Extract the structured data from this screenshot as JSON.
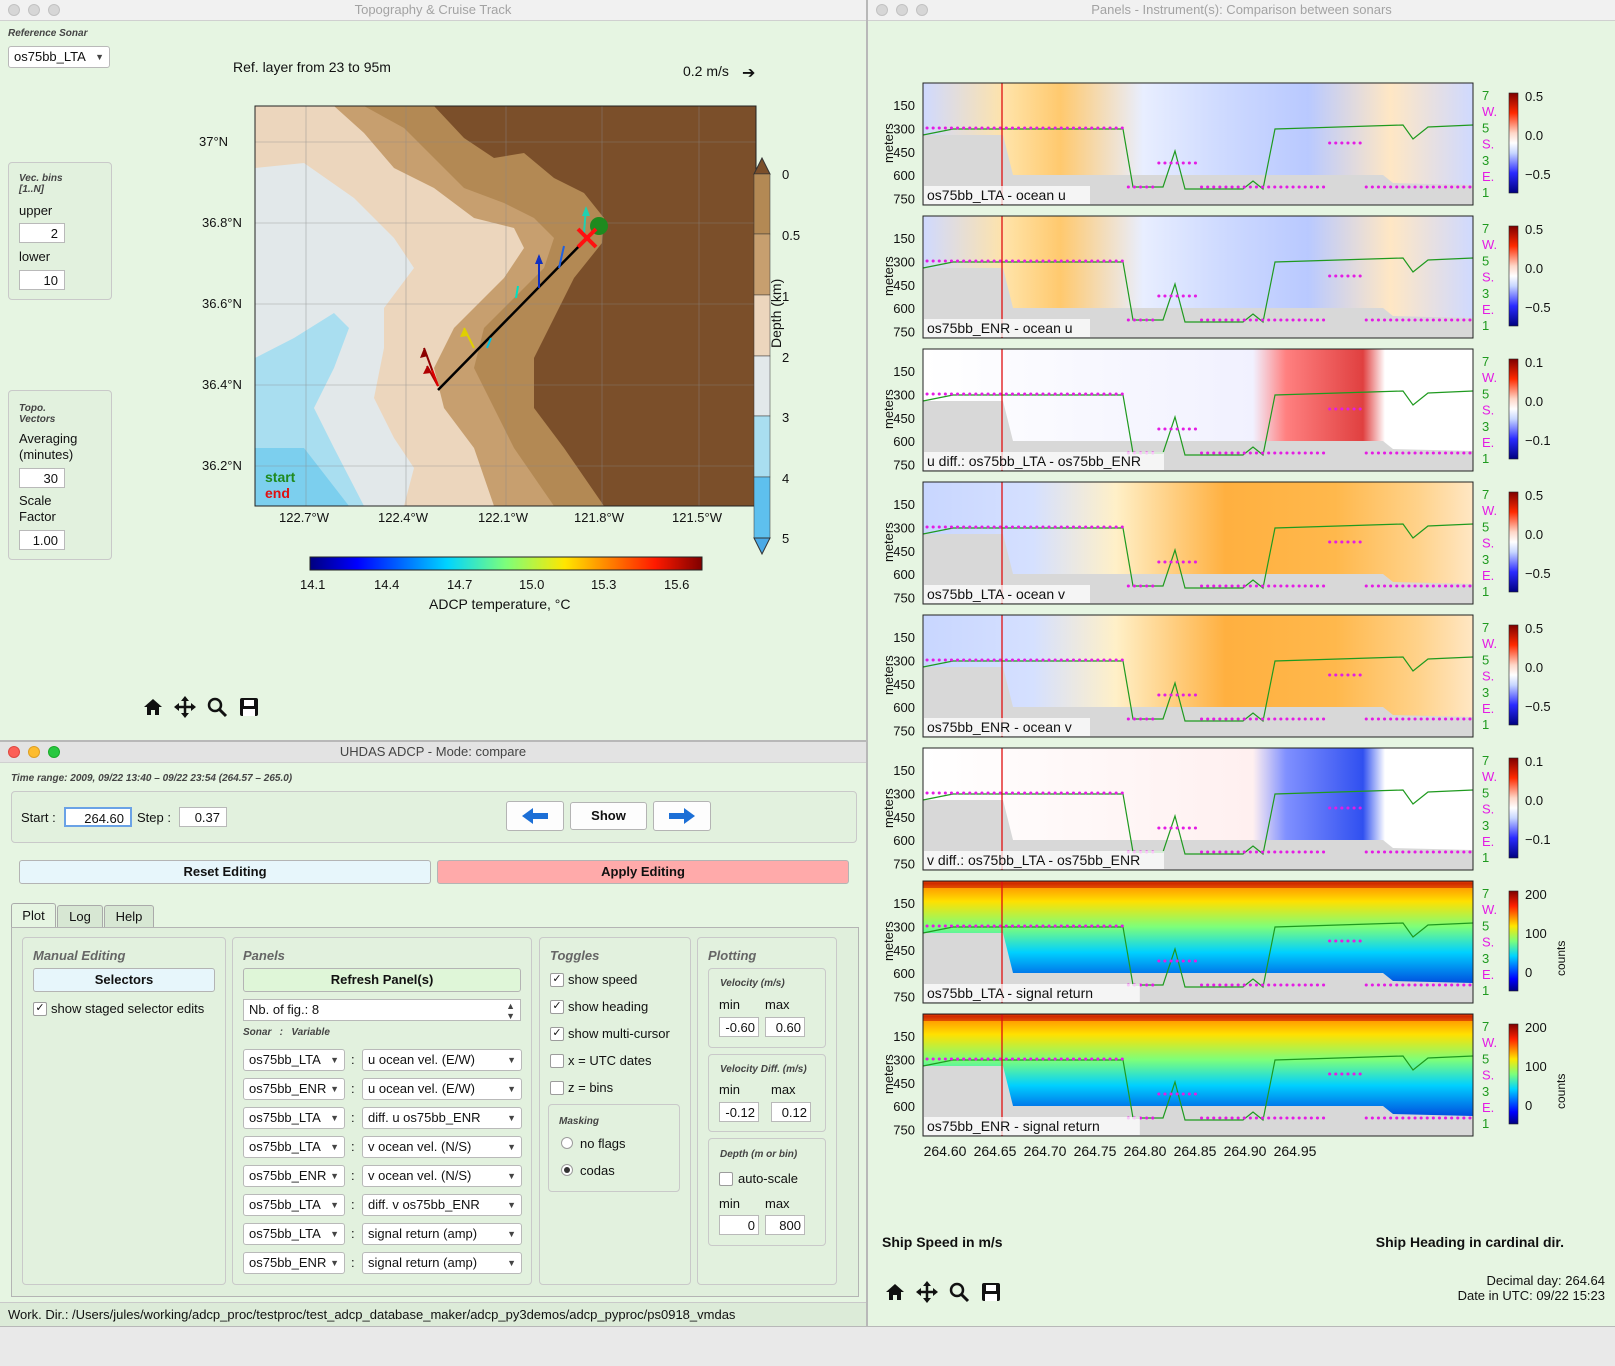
{
  "topo_window": {
    "title": "Topography & Cruise Track",
    "reference_sonar_label": "Reference Sonar",
    "reference_sonar_value": "os75bb_LTA",
    "vec_bins_label": "Vec. bins\n[1..N]",
    "upper_label": "upper",
    "upper_value": "2",
    "lower_label": "lower",
    "lower_value": "10",
    "topo_vectors_label": "Topo.\nVectors",
    "averaging_label": "Averaging\n(minutes)",
    "averaging_value": "30",
    "scale_factor_label": "Scale\nFactor",
    "scale_factor_value": "1.00",
    "ref_layer_text": "Ref. layer from 23 to 95m",
    "scale_arrow_text": "0.2 m/s",
    "lat_ticks": [
      "37°N",
      "36.8°N",
      "36.6°N",
      "36.4°N",
      "36.2°N"
    ],
    "lon_ticks": [
      "122.7°W",
      "122.4°W",
      "122.1°W",
      "121.8°W",
      "121.5°W"
    ],
    "depth_ticks": [
      "0",
      "0.5",
      "1",
      "2",
      "3",
      "4",
      "5"
    ],
    "depth_label": "Depth (km)",
    "temp_ticks": [
      "14.1",
      "14.4",
      "14.7",
      "15.0",
      "15.3",
      "15.6"
    ],
    "temp_label": "ADCP temperature, °C",
    "start_label": "start",
    "end_label": "end",
    "colors": {
      "start": "#1e8a1e",
      "end": "#e01010"
    }
  },
  "panels_window": {
    "title": "Panels - Instrument(s): Comparison between sonars",
    "ship_speed_label": "Ship Speed in m/s",
    "ship_heading_label": "Ship Heading in cardinal dir.",
    "decimal_day": "Decimal day: 264.64",
    "date_utc": "Date in UTC: 09/22 15:23",
    "x_ticks": [
      "264.60",
      "264.65",
      "264.70",
      "264.75",
      "264.80",
      "264.85",
      "264.90",
      "264.95"
    ],
    "y_ticks": [
      "150",
      "300",
      "450",
      "600",
      "750"
    ],
    "y_label": "meters",
    "right_ticks": [
      "7",
      "W.",
      "5",
      "S.",
      "3",
      "E.",
      "1"
    ],
    "panels": [
      {
        "label": "os75bb_LTA - ocean u",
        "kind": "vel",
        "cbar": [
          "0.5",
          "0.0",
          "−0.5"
        ],
        "cbar_unit": ""
      },
      {
        "label": "os75bb_ENR - ocean u",
        "kind": "vel",
        "cbar": [
          "0.5",
          "0.0",
          "−0.5"
        ],
        "cbar_unit": ""
      },
      {
        "label": "u diff.: os75bb_LTA - os75bb_ENR",
        "kind": "diffu",
        "cbar": [
          "0.1",
          "0.0",
          "−0.1"
        ],
        "cbar_unit": ""
      },
      {
        "label": "os75bb_LTA - ocean v",
        "kind": "velv",
        "cbar": [
          "0.5",
          "0.0",
          "−0.5"
        ],
        "cbar_unit": ""
      },
      {
        "label": "os75bb_ENR - ocean v",
        "kind": "velv",
        "cbar": [
          "0.5",
          "0.0",
          "−0.5"
        ],
        "cbar_unit": ""
      },
      {
        "label": "v diff.: os75bb_LTA - os75bb_ENR",
        "kind": "diffv",
        "cbar": [
          "0.1",
          "0.0",
          "−0.1"
        ],
        "cbar_unit": ""
      },
      {
        "label": "os75bb_LTA - signal return",
        "kind": "amp",
        "cbar": [
          "200",
          "100",
          "0"
        ],
        "cbar_unit": "counts"
      },
      {
        "label": "os75bb_ENR - signal return",
        "kind": "amp",
        "cbar": [
          "200",
          "100",
          "0"
        ],
        "cbar_unit": "counts"
      }
    ],
    "colors": {
      "speed": "#1f9a1f",
      "heading": "#e41ce4"
    }
  },
  "control_window": {
    "title": "UHDAS ADCP - Mode: compare",
    "time_range": "Time range: 2009, 09/22 13:40 – 09/22 23:54 (264.57 – 265.0)",
    "start_label": "Start :",
    "start_value": "264.60",
    "step_label": "Step :",
    "step_value": "0.37",
    "show_label": "Show",
    "reset_label": "Reset Editing",
    "apply_label": "Apply Editing",
    "tabs": [
      "Plot",
      "Log",
      "Help"
    ],
    "manual_editing_title": "Manual Editing",
    "selectors_label": "Selectors",
    "show_staged_label": "show staged selector edits",
    "panels_title": "Panels",
    "refresh_label": "Refresh Panel(s)",
    "nb_fig_label": "Nb. of fig.: 8",
    "sonar_variable_header": "Sonar   :   Variable",
    "rows": [
      {
        "sonar": "os75bb_LTA",
        "variable": "u ocean vel. (E/W)"
      },
      {
        "sonar": "os75bb_ENR",
        "variable": "u ocean vel. (E/W)"
      },
      {
        "sonar": "os75bb_LTA",
        "variable": "diff.  u os75bb_ENR"
      },
      {
        "sonar": "os75bb_LTA",
        "variable": "v ocean vel. (N/S)"
      },
      {
        "sonar": "os75bb_ENR",
        "variable": "v ocean vel. (N/S)"
      },
      {
        "sonar": "os75bb_LTA",
        "variable": "diff.  v os75bb_ENR"
      },
      {
        "sonar": "os75bb_LTA",
        "variable": "signal return (amp)"
      },
      {
        "sonar": "os75bb_ENR",
        "variable": "signal return (amp)"
      }
    ],
    "toggles_title": "Toggles",
    "toggles": [
      {
        "label": "show speed",
        "checked": true
      },
      {
        "label": "show heading",
        "checked": true
      },
      {
        "label": "show multi-cursor",
        "checked": true
      },
      {
        "label": "x = UTC dates",
        "checked": false
      },
      {
        "label": "z = bins",
        "checked": false
      }
    ],
    "masking_title": "Masking",
    "masking_options": [
      {
        "label": "no flags",
        "checked": false
      },
      {
        "label": "codas",
        "checked": true
      }
    ],
    "plotting_title": "Plotting",
    "velocity_title": "Velocity (m/s)",
    "velocity_min": "-0.60",
    "velocity_max": "0.60",
    "veldiff_title": "Velocity Diff. (m/s)",
    "veldiff_min": "-0.12",
    "veldiff_max": "0.12",
    "depth_title": "Depth (m or bin)",
    "autoscale_label": "auto-scale",
    "depth_min": "0",
    "depth_max": "800",
    "min_label": "min",
    "max_label": "max",
    "work_dir": "Work. Dir.: /Users/jules/working/adcp_proc/testproc/test_adcp_database_maker/adcp_py3demos/adcp_pyproc/ps0918_vmdas"
  }
}
